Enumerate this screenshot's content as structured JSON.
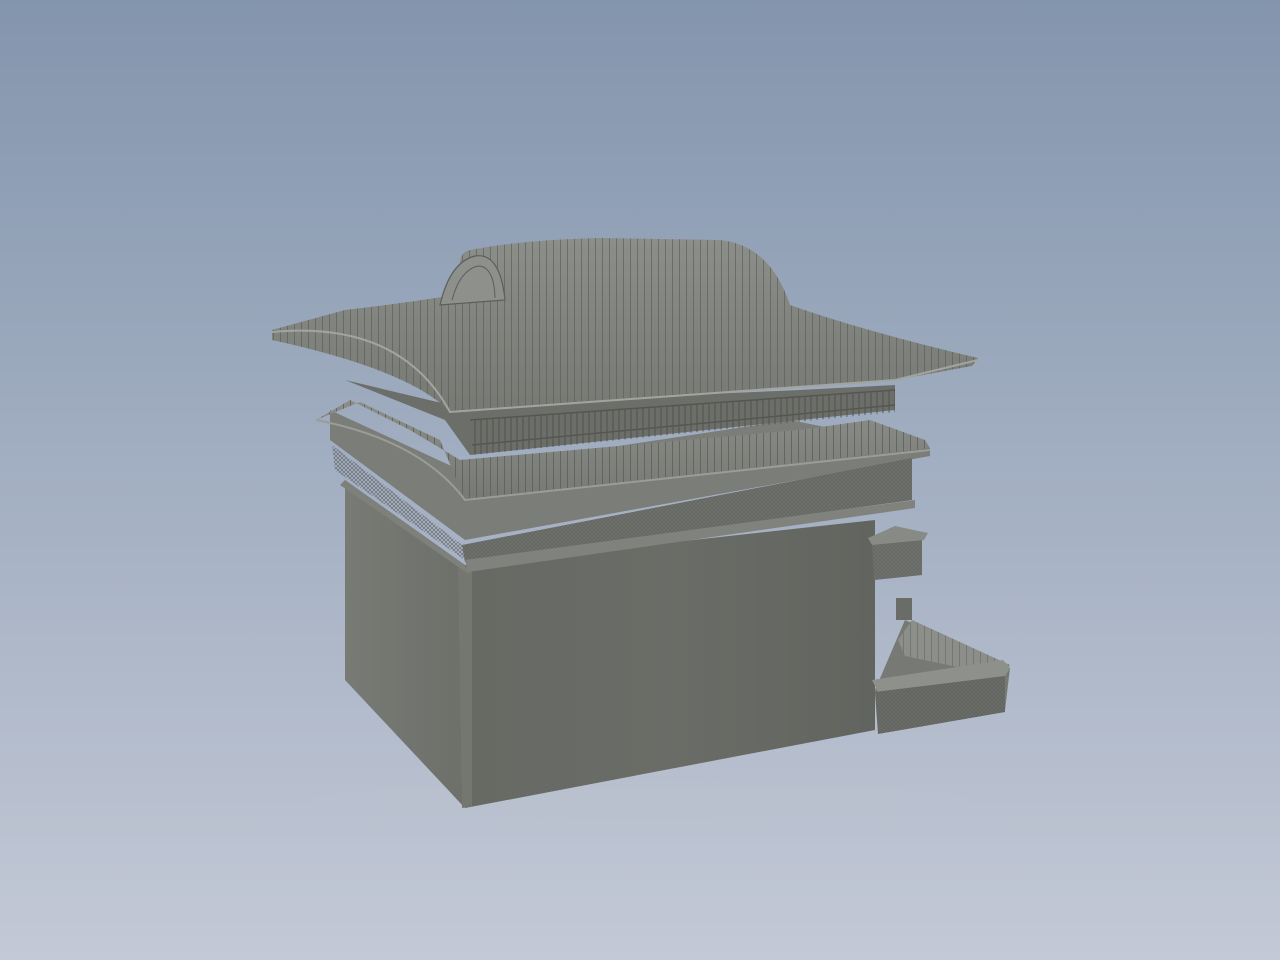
{
  "viewport": {
    "background_top": "#8395ad",
    "background_bottom": "#c3c9d6"
  },
  "model": {
    "subject": "japanese-style-bathhouse-3d-model",
    "material_color": "#6e706b",
    "roof_color": "#7a7c77"
  }
}
